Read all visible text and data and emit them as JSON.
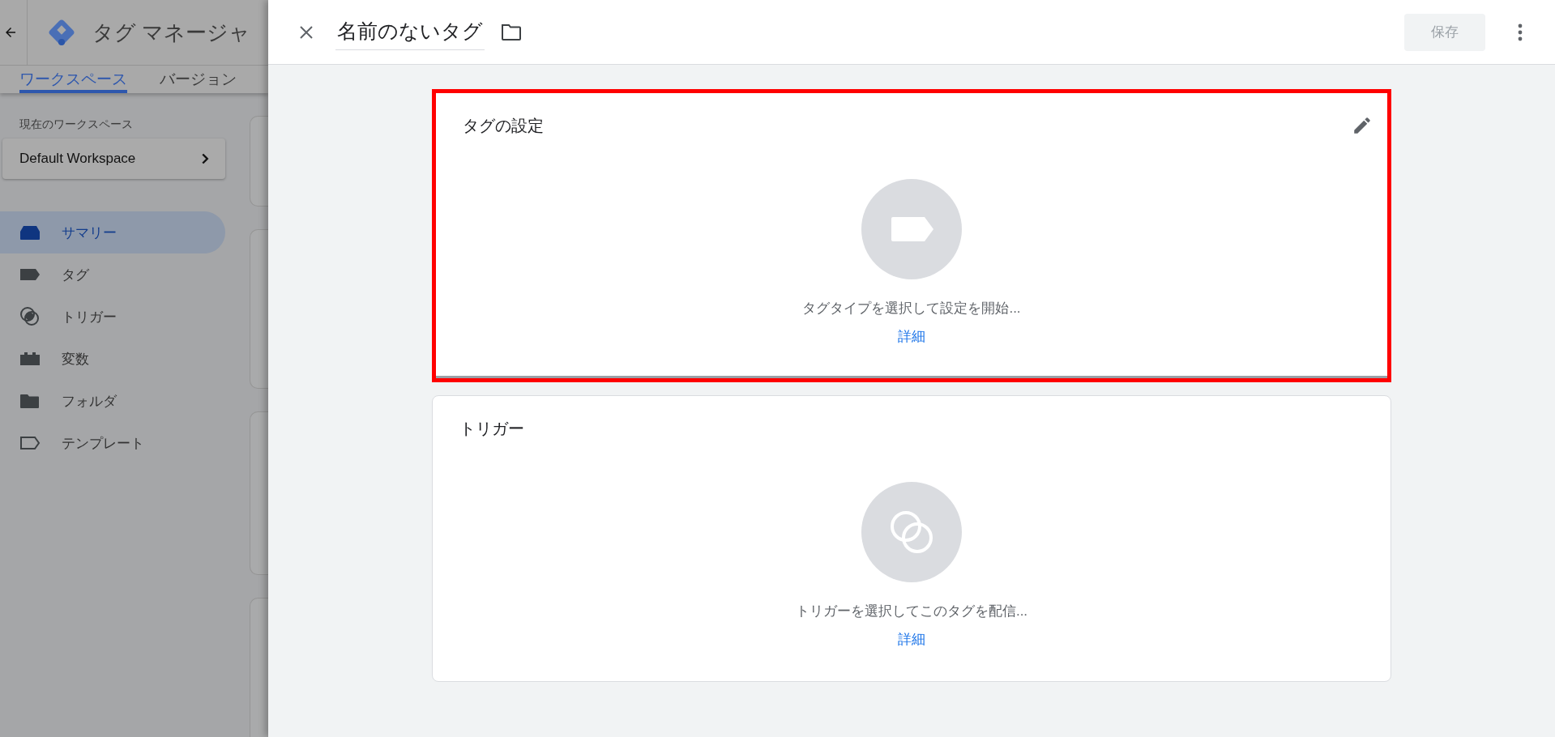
{
  "background_page": {
    "app_title": "タグ マネージャ",
    "tabs": [
      {
        "label": "ワークスペース",
        "selected": true
      },
      {
        "label": "バージョン",
        "selected": false
      }
    ],
    "workspace_caption": "現在のワークスペース",
    "workspace_name": "Default Workspace",
    "nav": [
      {
        "kind": "summary",
        "label": "サマリー",
        "selected": true
      },
      {
        "kind": "tag",
        "label": "タグ",
        "selected": false
      },
      {
        "kind": "trigger",
        "label": "トリガー",
        "selected": false
      },
      {
        "kind": "variable",
        "label": "変数",
        "selected": false
      },
      {
        "kind": "folder",
        "label": "フォルダ",
        "selected": false
      },
      {
        "kind": "template",
        "label": "テンプレート",
        "selected": false
      }
    ]
  },
  "editor": {
    "title": "名前のないタグ",
    "save_button": {
      "label": "保存",
      "disabled": true
    },
    "sections": [
      {
        "kind": "tag",
        "title": "タグの設定",
        "prompt": "タグタイプを選択して設定を開始...",
        "link": "詳細",
        "highlighted": true
      },
      {
        "kind": "trigger",
        "title": "トリガー",
        "prompt": "トリガーを選択してこのタグを配信...",
        "link": "詳細",
        "highlighted": false
      }
    ]
  }
}
